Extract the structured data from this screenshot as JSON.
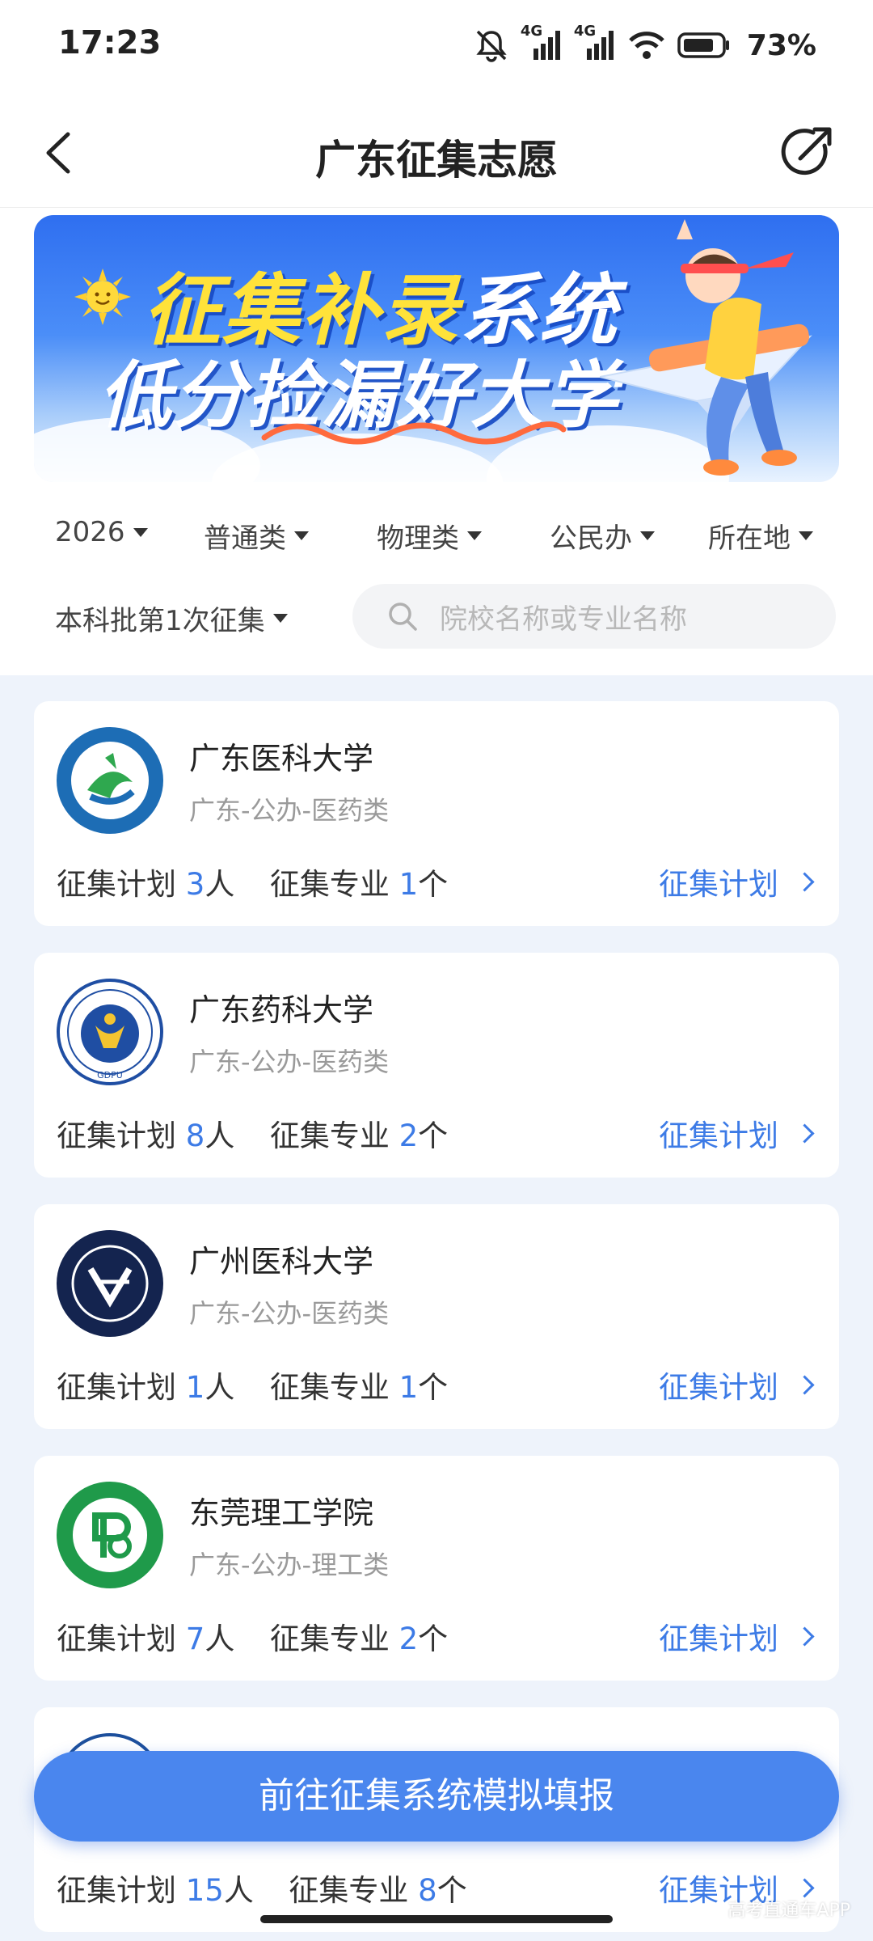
{
  "status_bar": {
    "time": "17:23",
    "net1": "4G",
    "net2": "4G",
    "battery": "73%"
  },
  "header": {
    "title": "广东征集志愿"
  },
  "banner": {
    "line1_a": "征集补录",
    "line1_b": "系统",
    "line2": "低分捡漏好大学"
  },
  "filters": {
    "year": "2026",
    "category": "普通类",
    "subject": "物理类",
    "ownership": "公民办",
    "location": "所在地",
    "batch": "本科批第1次征集"
  },
  "search": {
    "placeholder": "院校名称或专业名称"
  },
  "stat_labels": {
    "plan": "征集计划",
    "people_unit": "人",
    "major": "征集专业",
    "major_unit": "个",
    "link": "征集计划"
  },
  "schools": [
    {
      "name": "广东医科大学",
      "meta": "广东-公办-医药类",
      "plan": "3",
      "majors": "1"
    },
    {
      "name": "广东药科大学",
      "meta": "广东-公办-医药类",
      "plan": "8",
      "majors": "2"
    },
    {
      "name": "广州医科大学",
      "meta": "广东-公办-医药类",
      "plan": "1",
      "majors": "1"
    },
    {
      "name": "东莞理工学院",
      "meta": "广东-公办-理工类",
      "plan": "7",
      "majors": "2"
    },
    {
      "name": "",
      "meta": "",
      "plan": "15",
      "majors": "8"
    }
  ],
  "cta": {
    "label": "前往征集系统模拟填报"
  },
  "watermark": "高考直通车APP",
  "colors": {
    "accent": "#3d7be6",
    "cta": "#4a86ee",
    "list_bg": "#eef3fb"
  }
}
